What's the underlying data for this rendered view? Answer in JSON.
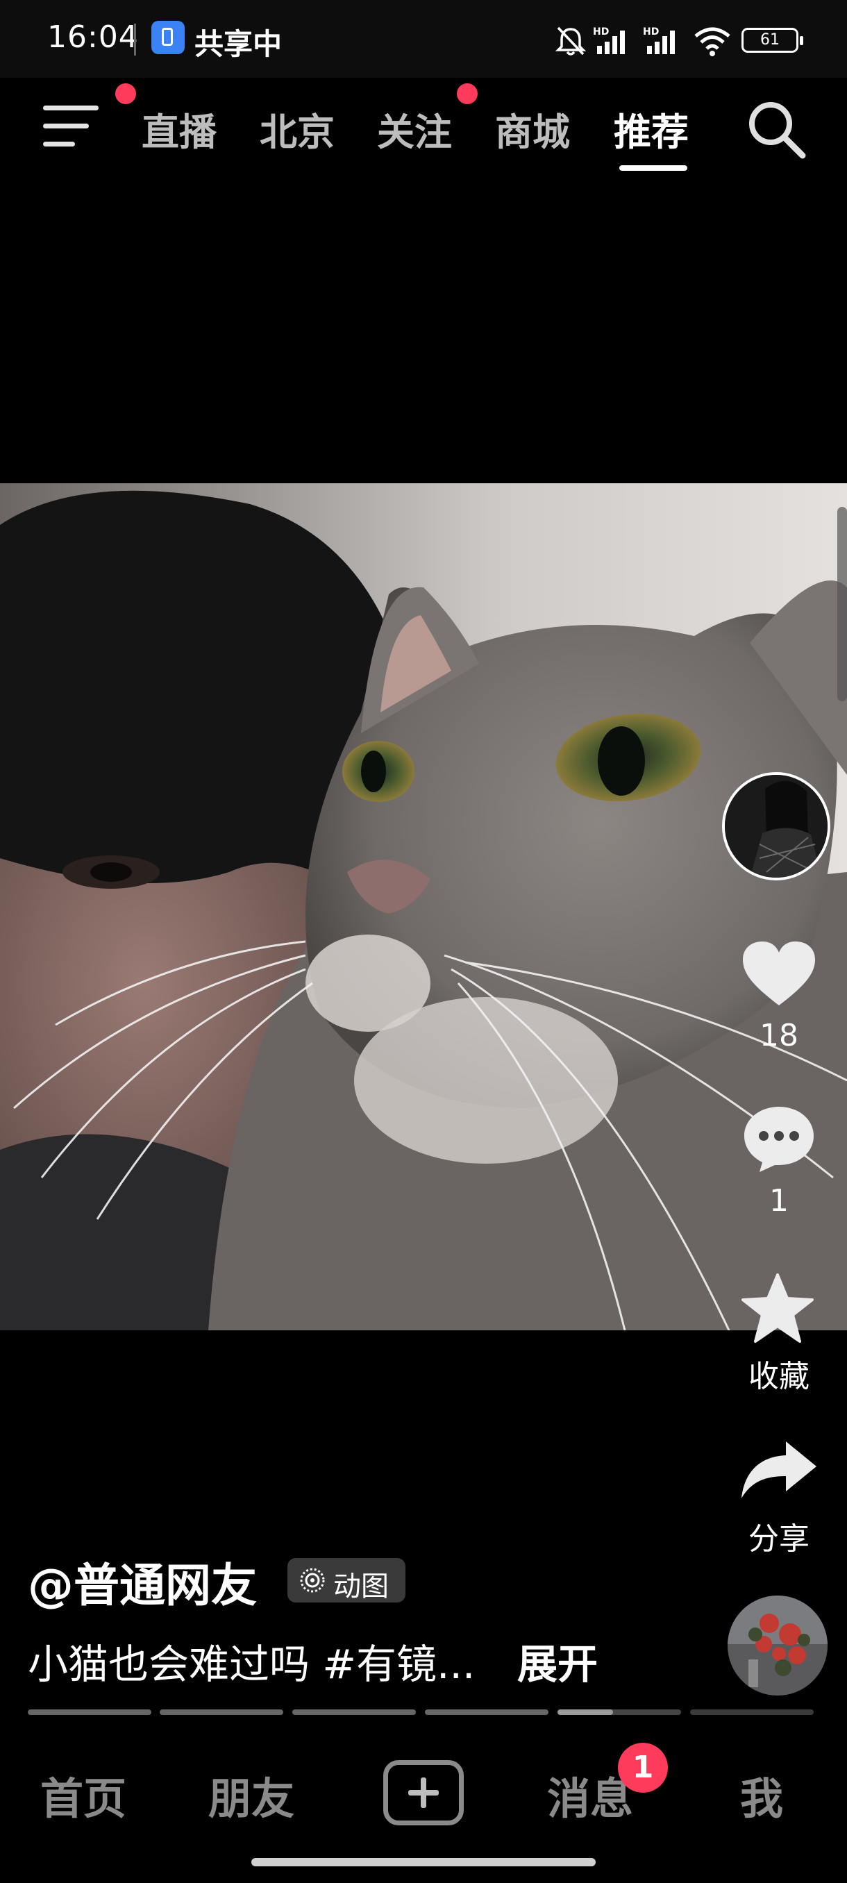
{
  "status_bar": {
    "time": "16:04",
    "sharing_label": "共享中",
    "battery_level": "61",
    "icons": [
      "share-screen-icon",
      "mute-bell-icon",
      "hd-signal-icon",
      "hd-signal-icon",
      "wifi-icon",
      "battery-icon"
    ]
  },
  "top_nav": {
    "tabs": [
      "直播",
      "北京",
      "关注",
      "商城",
      "推荐"
    ],
    "active_tab": "推荐",
    "menu_icon": "menu-icon",
    "search_icon": "search-icon"
  },
  "video": {
    "description_icon": "video-cat-and-person",
    "author": "@普通网友",
    "badge_label": "动图",
    "caption": "小猫也会难过吗 #有镜...",
    "expand_label": "展开",
    "progress": {
      "segments": 6,
      "current_segment": 5,
      "current_fill": 0.45
    }
  },
  "right_rail": {
    "like_count": "18",
    "comment_count": "1",
    "favorite_label": "收藏",
    "share_label": "分享",
    "icons": [
      "creator-avatar",
      "heart-icon",
      "comment-icon",
      "star-icon",
      "share-icon",
      "music-disc"
    ]
  },
  "bottom_nav": {
    "items": [
      "首页",
      "朋友",
      "消息",
      "我"
    ],
    "add_icon": "plus-icon",
    "message_badge": "1"
  },
  "colors": {
    "background": "#000000",
    "accent_red": "#ff3b5c",
    "inactive_nav": "#8a8a8a"
  }
}
